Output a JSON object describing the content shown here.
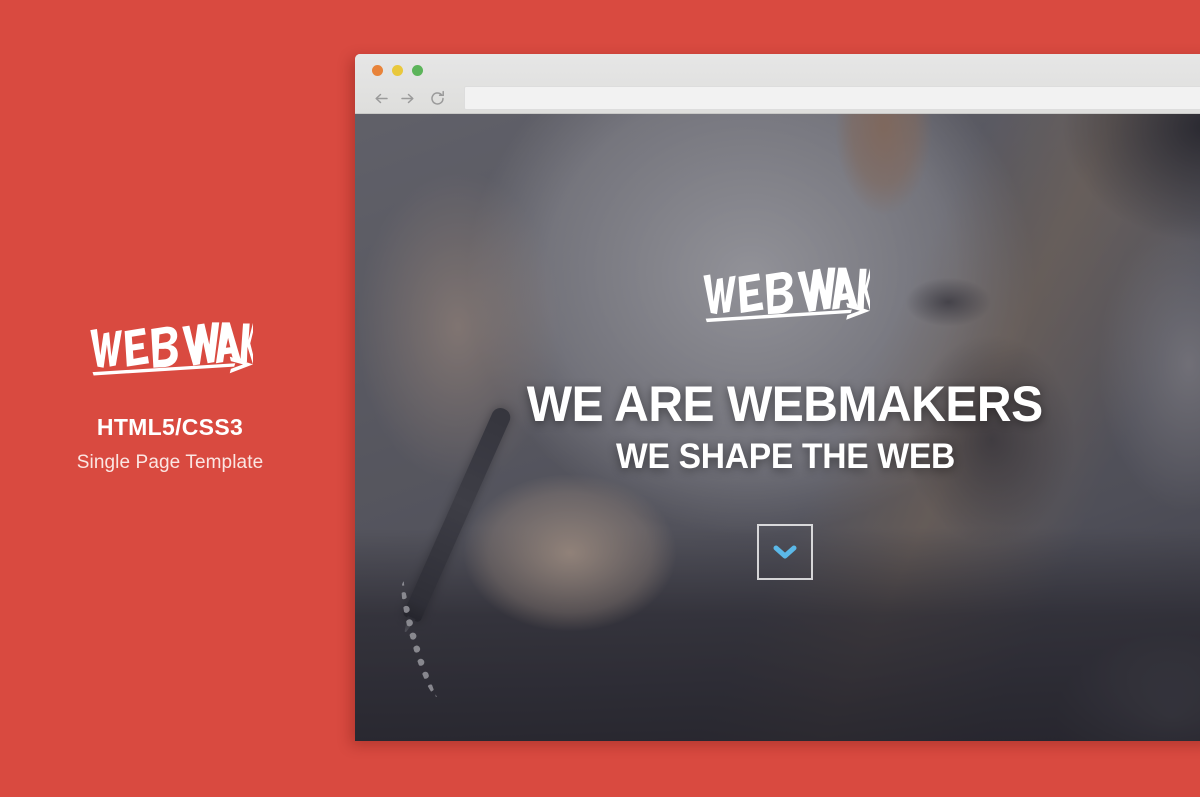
{
  "theme": {
    "background_color": "#d94a40",
    "accent_blue": "#5bb8e8",
    "text_white": "#ffffff"
  },
  "promo": {
    "logo_name": "webmakers-logo",
    "logo_wordmark": "WEBMAKERS",
    "title": "HTML5/CSS3",
    "subtitle": "Single Page Template"
  },
  "browser": {
    "traffic_lights": [
      {
        "name": "close",
        "color": "#e8833a"
      },
      {
        "name": "minimize",
        "color": "#e9c83c"
      },
      {
        "name": "zoom",
        "color": "#5cb45a"
      }
    ],
    "nav": {
      "back_label": "←",
      "forward_label": "→",
      "reload_label": "↻"
    },
    "address_bar": {
      "value": "",
      "placeholder": ""
    }
  },
  "hero": {
    "logo_wordmark": "WEBMAKERS",
    "headline": "WE ARE WEBMAKERS",
    "subheadline": "WE SHAPE THE WEB",
    "scroll_button": {
      "name": "scroll-down-button",
      "icon": "chevron-down-icon",
      "icon_color": "#5bb8e8"
    },
    "photo_description": "Person in a white t-shirt drawing with a stylus on a graphics tablet"
  }
}
